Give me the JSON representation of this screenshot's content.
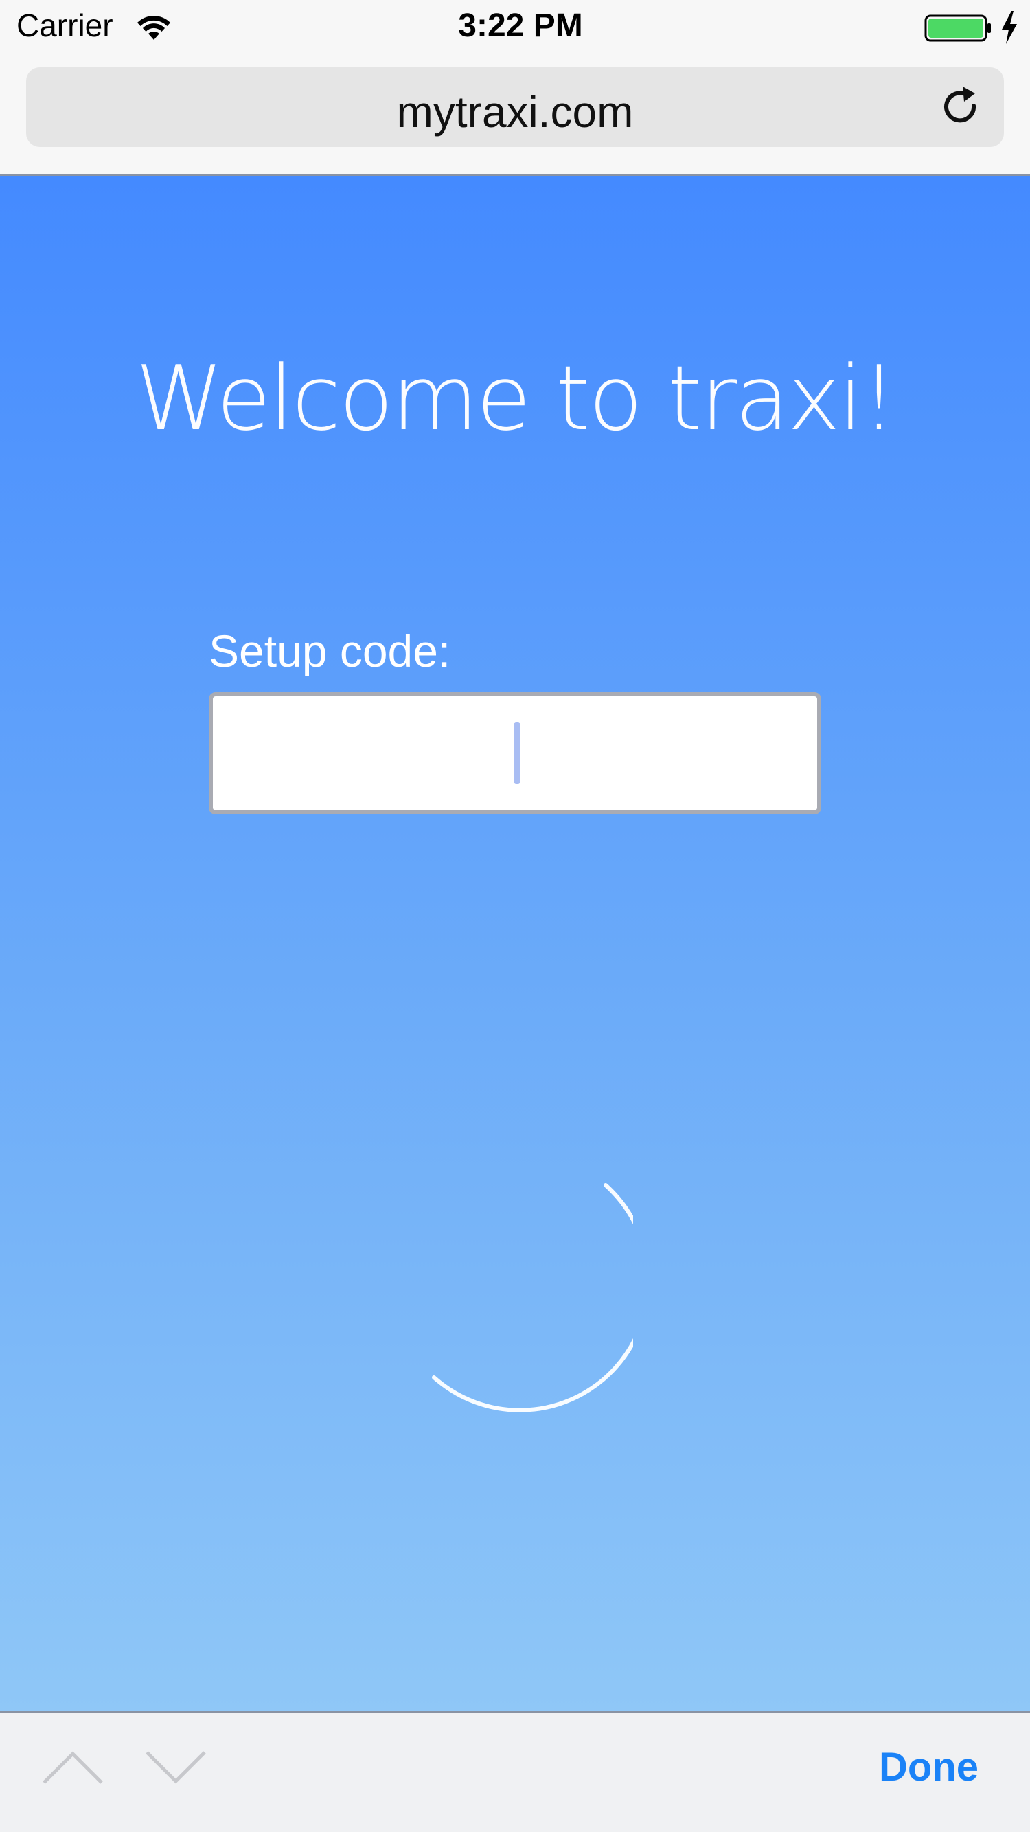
{
  "status_bar": {
    "carrier": "Carrier",
    "time": "3:22 PM",
    "wifi_icon": "wifi-icon",
    "battery_icon": "battery-icon",
    "charging_icon": "charging-bolt-icon",
    "battery_color": "#4cd964"
  },
  "browser": {
    "url": "mytraxi.com",
    "reload_icon": "reload-icon"
  },
  "page": {
    "welcome_title": "Welcome to traxi!",
    "setup_label": "Setup code:",
    "setup_input_value": "",
    "gradient_top_color": "#448aff",
    "gradient_bottom_color": "#8fc7f7",
    "spinner_icon": "loading-spinner-icon"
  },
  "accessory_bar": {
    "prev_icon": "chevron-up-icon",
    "next_icon": "chevron-down-icon",
    "done_label": "Done",
    "done_color": "#1a82f7"
  }
}
